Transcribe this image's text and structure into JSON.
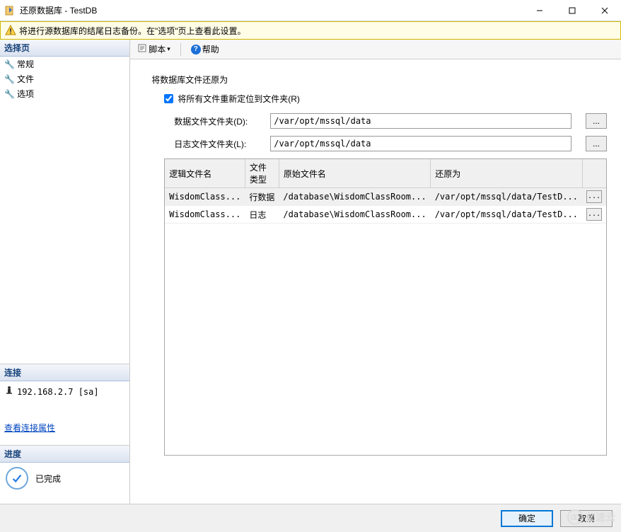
{
  "window": {
    "title": "还原数据库 - TestDB",
    "minimize": "—",
    "maximize": "☐",
    "close": "✕"
  },
  "warning": {
    "text": "将进行源数据库的结尾日志备份。在\"选项\"页上查看此设置。"
  },
  "left": {
    "select_page_header": "选择页",
    "nav": {
      "general": "常规",
      "files": "文件",
      "options": "选项"
    },
    "connection_header": "连接",
    "server_address": "192.168.2.7 [sa]",
    "view_conn_props": "查看连接属性",
    "progress_header": "进度",
    "progress_status": "已完成"
  },
  "toolbar": {
    "script": "脚本",
    "help": "帮助"
  },
  "content": {
    "restore_as_title": "将数据库文件还原为",
    "relocate_all": "将所有文件重新定位到文件夹(R)",
    "data_folder_label": "数据文件文件夹(D):",
    "log_folder_label": "日志文件文件夹(L):",
    "data_folder_value": "/var/opt/mssql/data",
    "log_folder_value": "/var/opt/mssql/data",
    "browse": "..."
  },
  "table": {
    "headers": {
      "logical": "逻辑文件名",
      "type": "文件类型",
      "original": "原始文件名",
      "restore_as": "还原为"
    },
    "rows": [
      {
        "logical": "WisdomClass...",
        "type": "行数据",
        "original": "/database\\WisdomClassRoom...",
        "restore_as": "/var/opt/mssql/data/TestD..."
      },
      {
        "logical": "WisdomClass...",
        "type": "日志",
        "original": "/database\\WisdomClassRoom...",
        "restore_as": "/var/opt/mssql/data/TestD..."
      }
    ]
  },
  "footer": {
    "ok": "确定",
    "cancel": "取消"
  },
  "watermark": {
    "text": "亿速云"
  }
}
